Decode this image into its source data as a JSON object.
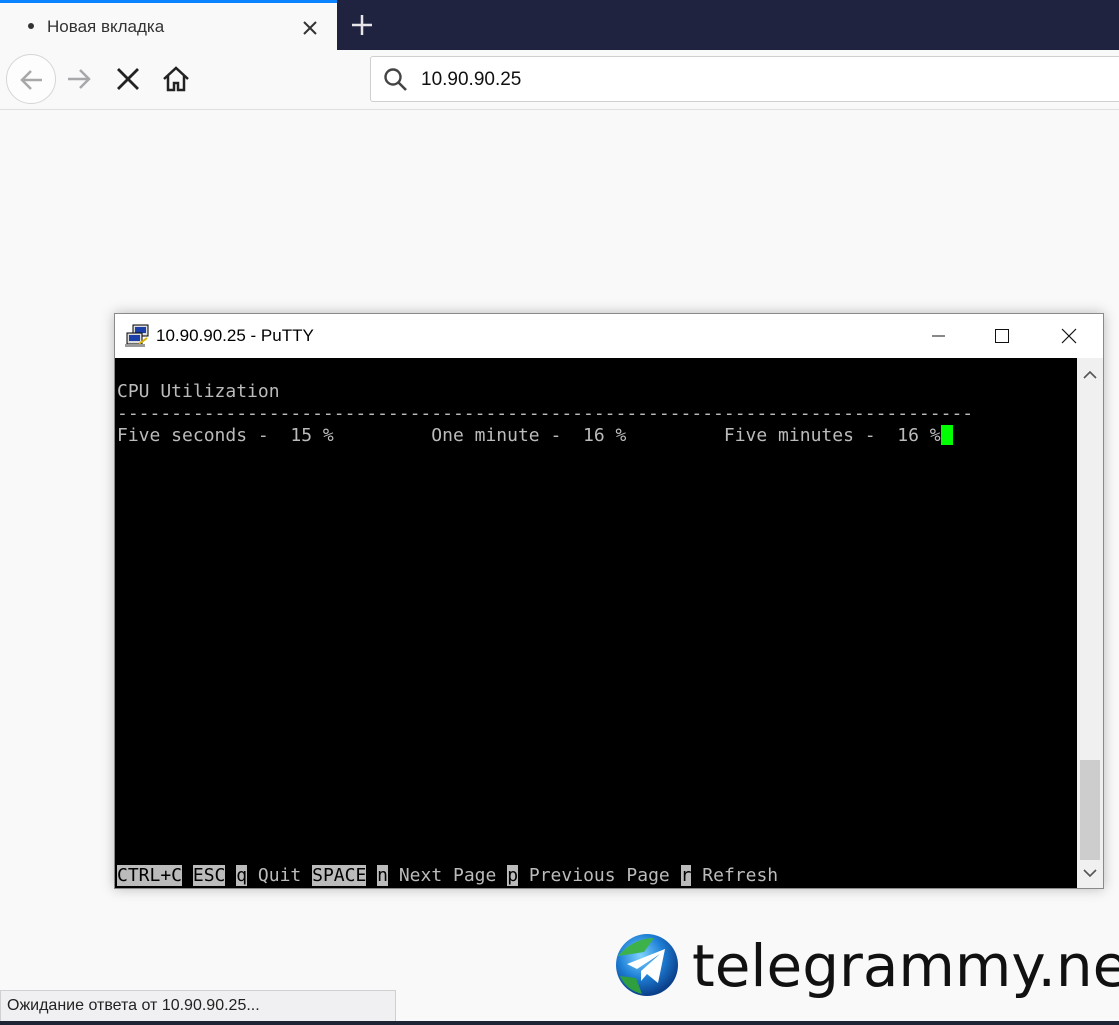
{
  "browser": {
    "tab_title": "Новая вкладка",
    "url": "10.90.90.25",
    "status": "Ожидание ответа от 10.90.90.25..."
  },
  "putty": {
    "title": "10.90.90.25 - PuTTY",
    "lines": {
      "header": "CPU Utilization",
      "divider": "-------------------------------------------------------------------------------",
      "values": "Five seconds -  15 %         One minute -  16 %         Five minutes -  16 %"
    },
    "footer": {
      "k1": "CTRL+C",
      "k2": "ESC",
      "k3": "q",
      "t3": " Quit ",
      "k4": "SPACE",
      "k5": "n",
      "t5": " Next Page ",
      "k6": "p",
      "t6": " Previous Page ",
      "k7": "r",
      "t7": " Refresh"
    }
  },
  "watermark": {
    "text": "telegrammy.net"
  },
  "colors": {
    "tab_accent": "#0a84ff",
    "tabstrip_bg": "#202340",
    "terminal_bg": "#000000",
    "terminal_fg": "#bbbbbb",
    "cursor": "#00ff00"
  },
  "icons": {
    "tab_loading": "loading-dot-icon",
    "tab_close": "close-icon",
    "new_tab": "plus-icon",
    "back": "arrow-left-icon",
    "forward": "arrow-right-icon",
    "stop": "stop-x-icon",
    "home": "home-icon",
    "search": "search-icon",
    "putty": "putty-icon",
    "minimize": "minimize-icon",
    "maximize": "maximize-icon",
    "close_window": "close-icon",
    "scroll_up": "chevron-up-icon",
    "scroll_down": "chevron-down-icon",
    "telegram": "telegram-logo-icon"
  }
}
